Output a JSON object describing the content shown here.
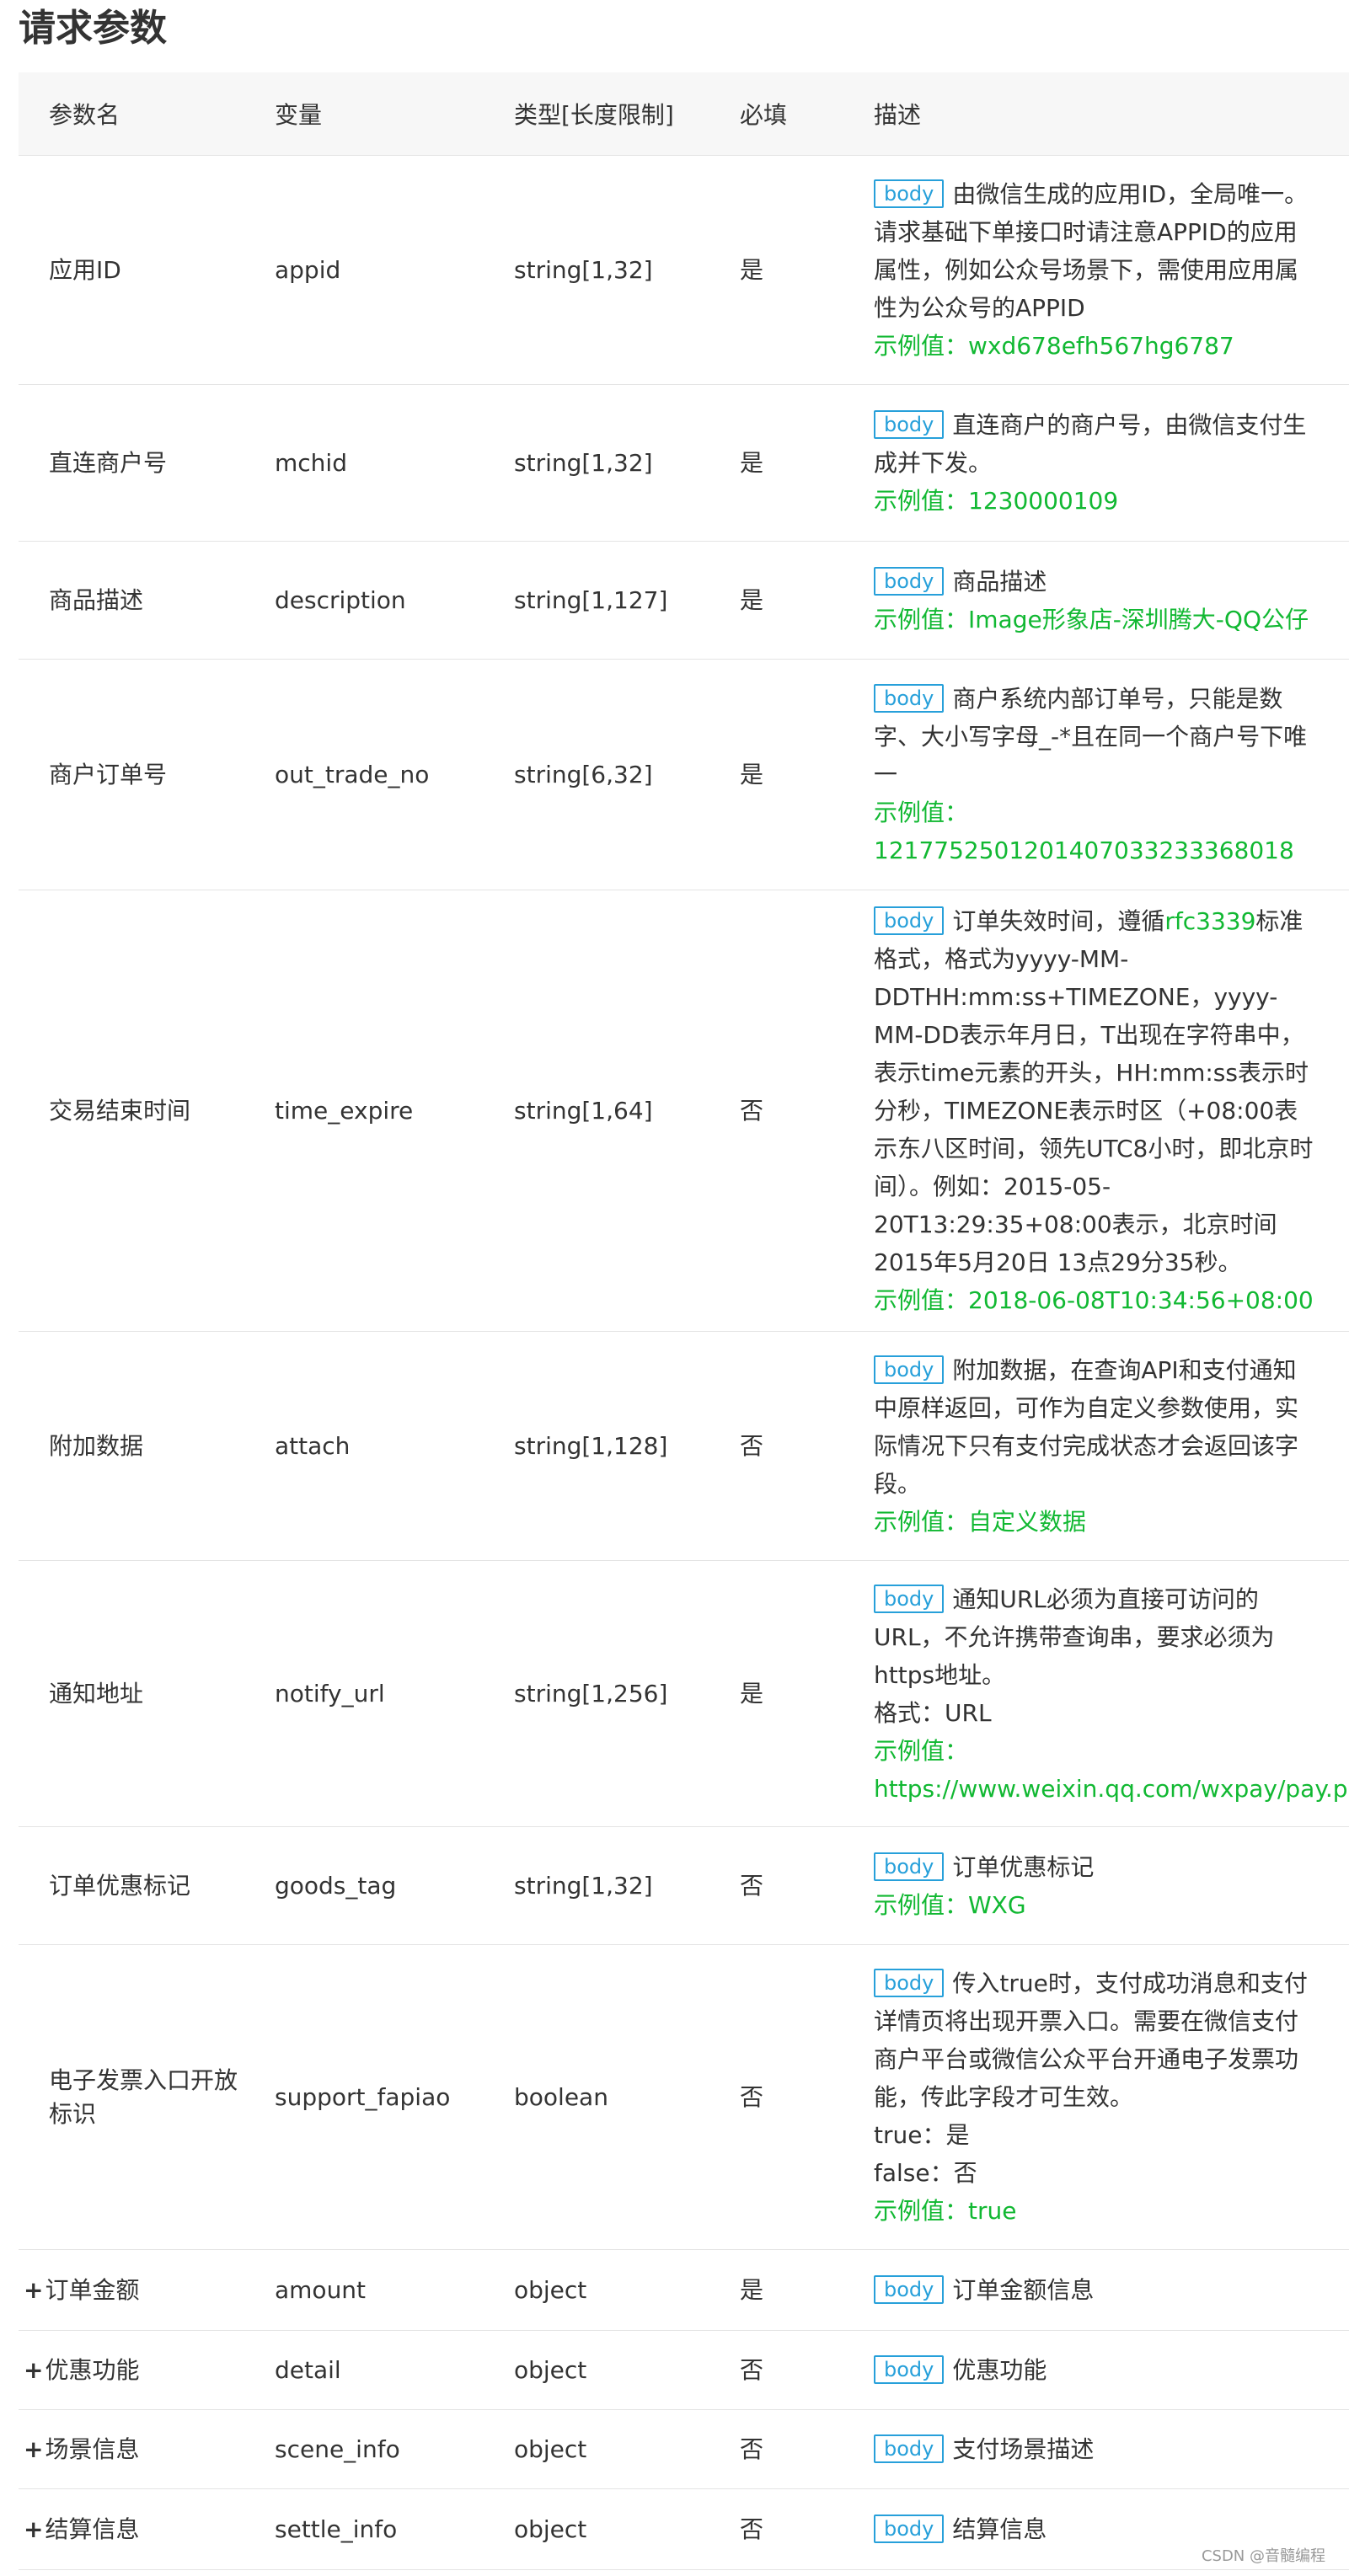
{
  "section_title": "请求参数",
  "headers": {
    "name": "参数名",
    "var": "变量",
    "type": "类型[长度限制]",
    "required": "必填",
    "desc": "描述"
  },
  "badge": "body",
  "rows": [
    {
      "name": "应用ID",
      "var": "appid",
      "type": "string[1,32]",
      "required": "是",
      "desc": "由微信生成的应用ID，全局唯一。请求基础下单接口时请注意APPID的应用属性，例如公众号场景下，需使用应用属性为公众号的APPID",
      "example": "示例值：wxd678efh567hg6787"
    },
    {
      "name": "直连商户号",
      "var": "mchid",
      "type": "string[1,32]",
      "required": "是",
      "desc": "直连商户的商户号，由微信支付生成并下发。",
      "example": "示例值：1230000109"
    },
    {
      "name": "商品描述",
      "var": "description",
      "type": "string[1,127]",
      "required": "是",
      "desc": "商品描述",
      "example": "示例值：Image形象店-深圳腾大-QQ公仔"
    },
    {
      "name": "商户订单号",
      "var": "out_trade_no",
      "type": "string[6,32]",
      "required": "是",
      "desc": "商户系统内部订单号，只能是数字、大小写字母_-*且在同一个商户号下唯一",
      "example": "示例值：1217752501201407033233368018"
    },
    {
      "name": "交易结束时间",
      "var": "time_expire",
      "type": "string[1,64]",
      "required": "否",
      "desc_pre": "订单失效时间，遵循",
      "desc_link": "rfc3339",
      "desc": "标准格式，格式为yyyy-MM-DDTHH:mm:ss+TIMEZONE，yyyy-MM-DD表示年月日，T出现在字符串中，表示time元素的开头，HH:mm:ss表示时分秒，TIMEZONE表示时区（+08:00表示东八区时间，领先UTC8小时，即北京时间）。例如：2015-05-20T13:29:35+08:00表示，北京时间2015年5月20日 13点29分35秒。",
      "example": "示例值：2018-06-08T10:34:56+08:00"
    },
    {
      "name": "附加数据",
      "var": "attach",
      "type": "string[1,128]",
      "required": "否",
      "desc": "附加数据，在查询API和支付通知中原样返回，可作为自定义参数使用，实际情况下只有支付完成状态才会返回该字段。",
      "example": "示例值：自定义数据"
    },
    {
      "name": "通知地址",
      "var": "notify_url",
      "type": "string[1,256]",
      "required": "是",
      "desc": "通知URL必须为直接可访问的URL，不允许携带查询串，要求必须为https地址。",
      "desc_extra": "格式：URL",
      "example": "示例值：https://www.weixin.qq.com/wxpay/pay.php"
    },
    {
      "name": "订单优惠标记",
      "var": "goods_tag",
      "type": "string[1,32]",
      "required": "否",
      "desc": "订单优惠标记",
      "example": "示例值：WXG"
    },
    {
      "name": "电子发票入口开放标识",
      "var": "support_fapiao",
      "type": "boolean",
      "required": "否",
      "desc": "传入true时，支付成功消息和支付详情页将出现开票入口。需要在微信支付商户平台或微信公众平台开通电子发票功能，传此字段才可生效。",
      "desc_lines": [
        "true：是",
        "false：否"
      ],
      "example": "示例值：true"
    },
    {
      "name": "订单金额",
      "var": "amount",
      "type": "object",
      "required": "是",
      "desc": "订单金额信息",
      "expand": "+"
    },
    {
      "name": "优惠功能",
      "var": "detail",
      "type": "object",
      "required": "否",
      "desc": "优惠功能",
      "expand": "+"
    },
    {
      "name": "场景信息",
      "var": "scene_info",
      "type": "object",
      "required": "否",
      "desc": "支付场景描述",
      "expand": "+"
    },
    {
      "name": "结算信息",
      "var": "settle_info",
      "type": "object",
      "required": "否",
      "desc": "结算信息",
      "expand": "+"
    }
  ],
  "watermark": "CSDN @音髓编程",
  "colors": {
    "badge": "#27a0da",
    "example": "#11b832",
    "header_bg": "#f7f7f7"
  }
}
